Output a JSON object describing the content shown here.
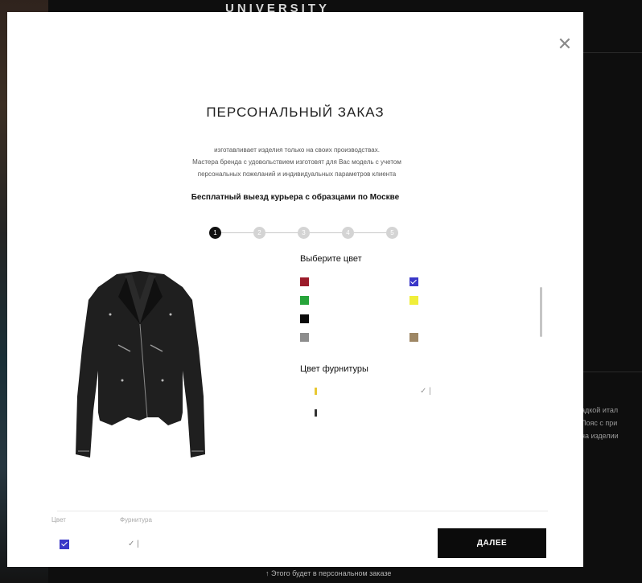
{
  "background": {
    "logo": "UNIVERSITY",
    "side_text": [
      "адкой итал",
      "Пояс с при",
      "на изделии"
    ],
    "bottom_text": "↑  Этого будет в персональном заказе"
  },
  "modal": {
    "close_icon": "close-icon",
    "title": "ПЕРСОНАЛЬНЫЙ ЗАКАЗ",
    "description": [
      "изготавливает изделия только на своих производствах.",
      "Мастера бренда с удовольствием изготовят для Вас модель с учетом",
      "персональных пожеланий и индивидуальных параметров клиента"
    ],
    "courier_text": "Бесплатный выезд курьера с образцами по Москве",
    "steps": [
      "1",
      "2",
      "3",
      "4",
      "5"
    ],
    "active_step": 1,
    "color_section": {
      "label": "Выберите цвет",
      "swatches": [
        {
          "color": "#9b1b2a",
          "selected": false
        },
        {
          "color": "#3a37c8",
          "selected": true
        },
        {
          "color": "#27a43a",
          "selected": false
        },
        {
          "color": "#f0ee3a",
          "selected": false
        },
        {
          "color": "#0a0a0a",
          "selected": false
        },
        {
          "color": "#8d8d8d",
          "selected": false
        },
        {
          "color": "#9e8765",
          "selected": false
        }
      ]
    },
    "hardware_section": {
      "label": "Цвет фурнитуры",
      "options": [
        {
          "color": "#e8c832",
          "selected": false
        },
        {
          "color": "#c9c9c9",
          "selected": true,
          "mark": "✓ |"
        },
        {
          "color": "#333333",
          "selected": false
        }
      ]
    },
    "summary": {
      "color_label": "Цвет",
      "hardware_label": "Фурнитура",
      "hardware_value": "✓ |"
    },
    "next_button": "ДАЛЕЕ"
  }
}
